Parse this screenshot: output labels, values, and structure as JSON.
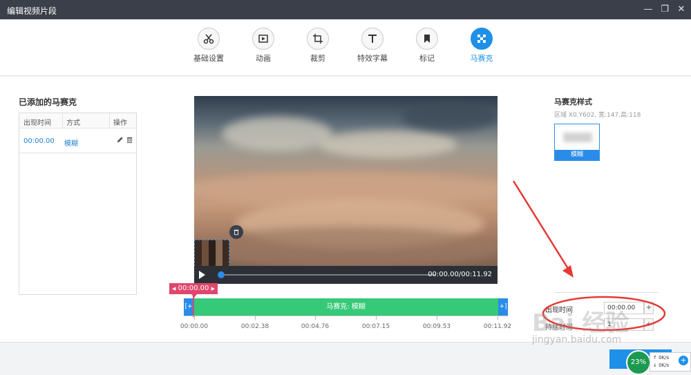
{
  "window": {
    "title": "编辑视频片段",
    "minimize": "—",
    "maximize": "❐",
    "close": "✕"
  },
  "toolbar": {
    "tools": [
      {
        "label": "基础设置",
        "icon": "scissors-icon",
        "active": false
      },
      {
        "label": "动画",
        "icon": "animation-icon",
        "active": false
      },
      {
        "label": "裁剪",
        "icon": "crop-icon",
        "active": false
      },
      {
        "label": "特效字幕",
        "icon": "text-icon",
        "active": false
      },
      {
        "label": "标记",
        "icon": "bookmark-icon",
        "active": false
      },
      {
        "label": "马赛克",
        "icon": "mosaic-icon",
        "active": true
      }
    ],
    "accent": "#1e90e8"
  },
  "mosaic_list": {
    "title": "已添加的马赛克",
    "columns": [
      "出现时间",
      "方式",
      "操作"
    ],
    "rows": [
      {
        "time": "00:00.00",
        "method": "模糊",
        "actions": [
          "edit-icon",
          "trash-icon"
        ]
      }
    ]
  },
  "player": {
    "timecode": "00:00.00/00:11.92",
    "progress": 0.0
  },
  "timeline": {
    "marker_time": "00:00.00",
    "track_label": "马赛克: 模糊",
    "handle_left": "[+",
    "handle_right": "+]",
    "ticks": [
      "00:00.00",
      "00:02.38",
      "00:04.76",
      "00:07.15",
      "00:09.53",
      "00:11.92"
    ],
    "track_color": "#35c978",
    "marker_color": "#e0466d"
  },
  "mosaic_style": {
    "title": "马赛克样式",
    "region": "区域 X0,Y602, 宽:147,高:118",
    "option_label": "模糊"
  },
  "timing": {
    "appear_label": "出现时间",
    "appear_value": "00:00.00",
    "appear_step": "+",
    "duration_label": "持续时间",
    "duration_value": "1",
    "duration_step": "+"
  },
  "tray": {
    "cpu": "23%",
    "up": "0K/s",
    "down": "0K/s",
    "plus": "+"
  },
  "watermark": {
    "text": "Bai 经验",
    "url": "jingyan.baidu.com"
  }
}
